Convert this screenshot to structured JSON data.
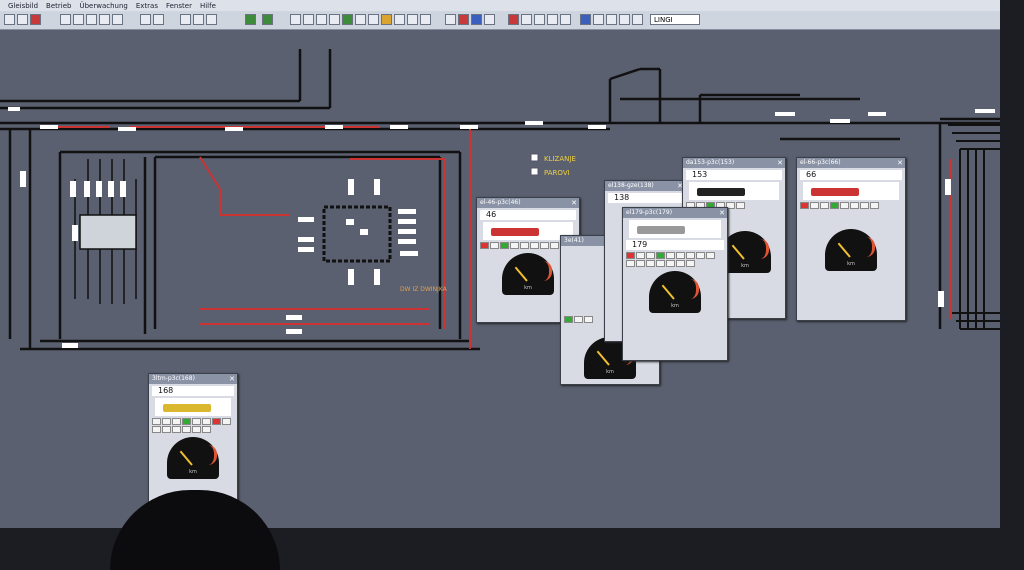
{
  "menu": [
    "Gleisbild",
    "Betrieb",
    "Überwachung",
    "Extras",
    "Fenster",
    "Hilfe"
  ],
  "toolbar": {
    "selector_value": "LINGI"
  },
  "legend": {
    "item1": "KLIZANJE",
    "item2": "PAROVI"
  },
  "yard_label": "DW IZ DWINJKA",
  "throttles": [
    {
      "title": "el-46-p3c(46)",
      "speed": "46",
      "gauge_min": "0",
      "gauge_max": "120",
      "unit": "km"
    },
    {
      "title": "3e(41)",
      "speed": "",
      "gauge_min": "0",
      "gauge_max": "140",
      "unit": "km"
    },
    {
      "title": "el138-gze(138)",
      "speed": "138",
      "gauge_min": "0",
      "gauge_max": "120",
      "unit": "km"
    },
    {
      "title": "da153-p3c(153)",
      "speed": "153",
      "gauge_min": "0",
      "gauge_max": "120",
      "unit": "km"
    },
    {
      "title": "el179-p3c(179)",
      "speed": "179",
      "gauge_min": "0",
      "gauge_max": "120",
      "unit": "km"
    },
    {
      "title": "el-66-p3c(66)",
      "speed": "66",
      "gauge_min": "0",
      "gauge_max": "120",
      "unit": "km"
    },
    {
      "title": "3ltm-p3c(168)",
      "speed": "168",
      "gauge_min": "0",
      "gauge_max": "120",
      "unit": "km"
    }
  ],
  "colors": {
    "accent_red": "#c33",
    "signal_yellow": "#f0d040",
    "track": "#111111",
    "background": "#5a6070"
  }
}
